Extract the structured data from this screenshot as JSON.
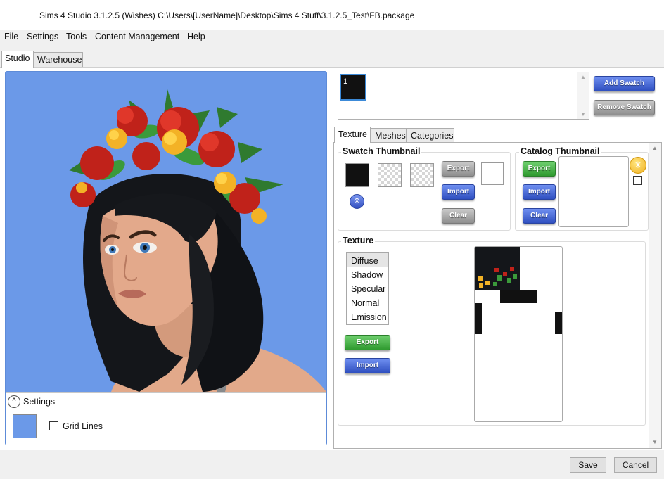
{
  "window": {
    "title": "Sims 4 Studio 3.1.2.5 (Wishes)  C:\\Users\\[UserName]\\Desktop\\Sims 4 Stuff\\3.1.2.5_Test\\FB.package"
  },
  "menu": [
    "File",
    "Settings",
    "Tools",
    "Content Management",
    "Help"
  ],
  "main_tabs": [
    {
      "label": "Studio",
      "active": true
    },
    {
      "label": "Warehouse",
      "active": false
    }
  ],
  "preview": {
    "background_color": "#6b99e8",
    "settings_label": "Settings",
    "grid_lines_label": "Grid Lines",
    "grid_lines_checked": false
  },
  "swatch_list": {
    "items": [
      {
        "label": "1",
        "color": "#111111",
        "selected": true
      }
    ],
    "add_label": "Add Swatch",
    "remove_label": "Remove Swatch"
  },
  "inner_tabs": [
    {
      "label": "Texture",
      "active": true
    },
    {
      "label": "Meshes",
      "active": false
    },
    {
      "label": "Categories",
      "active": false
    }
  ],
  "swatch_thumbnail": {
    "title": "Swatch Thumbnail",
    "export_label": "Export",
    "import_label": "Import",
    "clear_label": "Clear"
  },
  "catalog_thumbnail": {
    "title": "Catalog Thumbnail",
    "export_label": "Export",
    "import_label": "Import",
    "clear_label": "Clear"
  },
  "texture": {
    "title": "Texture",
    "types": [
      "Diffuse",
      "Shadow",
      "Specular",
      "Normal",
      "Emission"
    ],
    "selected": "Diffuse",
    "export_label": "Export",
    "import_label": "Import"
  },
  "footer": {
    "save_label": "Save",
    "cancel_label": "Cancel"
  },
  "colors": {
    "accent_blue": "#5d8bd8",
    "button_green": "#3aa83a",
    "button_blue": "#3a5ad0",
    "button_grey": "#9e9e9e"
  }
}
